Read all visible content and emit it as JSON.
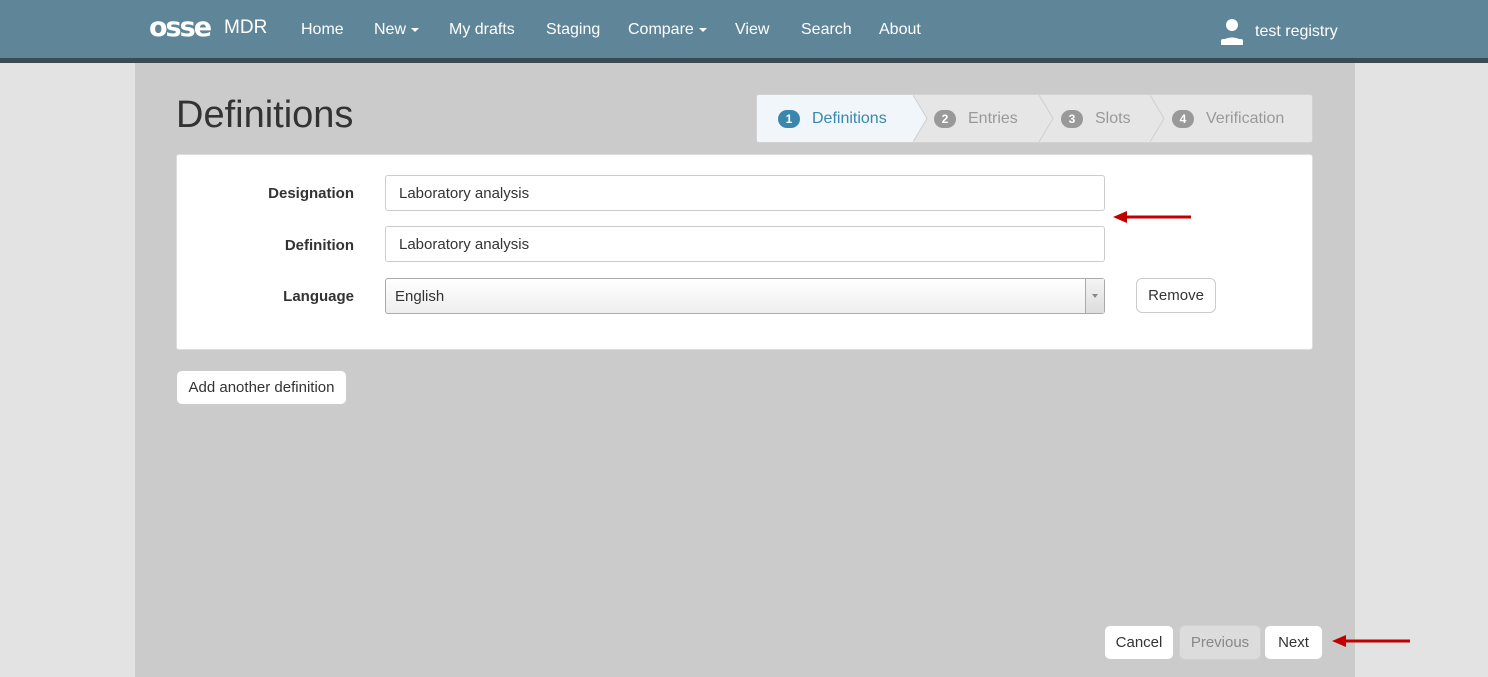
{
  "navbar": {
    "brand_logo": "osse",
    "brand_name": "MDR",
    "items": [
      {
        "label": "Home"
      },
      {
        "label": "New"
      },
      {
        "label": "My drafts"
      },
      {
        "label": "Staging"
      },
      {
        "label": "Compare"
      },
      {
        "label": "View"
      },
      {
        "label": "Search"
      },
      {
        "label": "About"
      }
    ],
    "user": {
      "icon": "user-icon",
      "name": "test registry"
    }
  },
  "page": {
    "title": "Definitions"
  },
  "wizard": {
    "steps": [
      {
        "number": "1",
        "label": "Definitions",
        "active": true
      },
      {
        "number": "2",
        "label": "Entries",
        "active": false
      },
      {
        "number": "3",
        "label": "Slots",
        "active": false
      },
      {
        "number": "4",
        "label": "Verification",
        "active": false
      }
    ]
  },
  "form": {
    "designation_label": "Designation",
    "designation_value": "Laboratory analysis",
    "definition_label": "Definition",
    "definition_value": "Laboratory analysis",
    "language_label": "Language",
    "language_value": "English",
    "remove_label": "Remove"
  },
  "actions": {
    "add_definition_label": "Add another definition",
    "cancel_label": "Cancel",
    "previous_label": "Previous",
    "next_label": "Next"
  },
  "colors": {
    "navbar_bg": "#5f8599",
    "navbar_border": "#3b4a53",
    "container_bg": "#cbcbcb",
    "active_step": "#3a87ad",
    "annotation_arrow": "#c00000"
  }
}
